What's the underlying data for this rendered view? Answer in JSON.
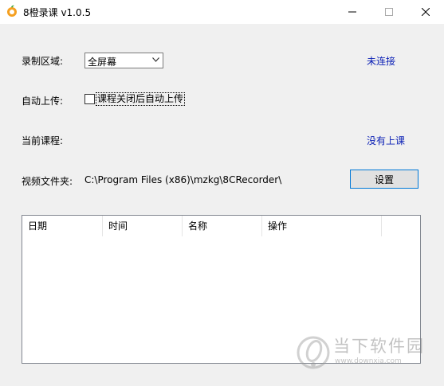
{
  "window": {
    "title": "8橙录课 v1.0.5",
    "accent": "#0078d7",
    "link_color": "#0a1fb5"
  },
  "form": {
    "record_area_label": "录制区域:",
    "record_area_value": "全屏幕",
    "connection_status": "未连接",
    "auto_upload_label": "自动上传:",
    "auto_upload_option": "课程关闭后自动上传",
    "auto_upload_checked": false,
    "current_course_label": "当前课程:",
    "course_status": "没有上课",
    "video_folder_label": "视频文件夹:",
    "video_folder_path": "C:\\Program Files (x86)\\mzkg\\8CRecorder\\",
    "settings_button": "设置"
  },
  "table": {
    "columns": [
      "日期",
      "时间",
      "名称",
      "操作"
    ],
    "rows": []
  },
  "watermark": {
    "title": "当下软件园",
    "url": "www.downxia.com"
  }
}
